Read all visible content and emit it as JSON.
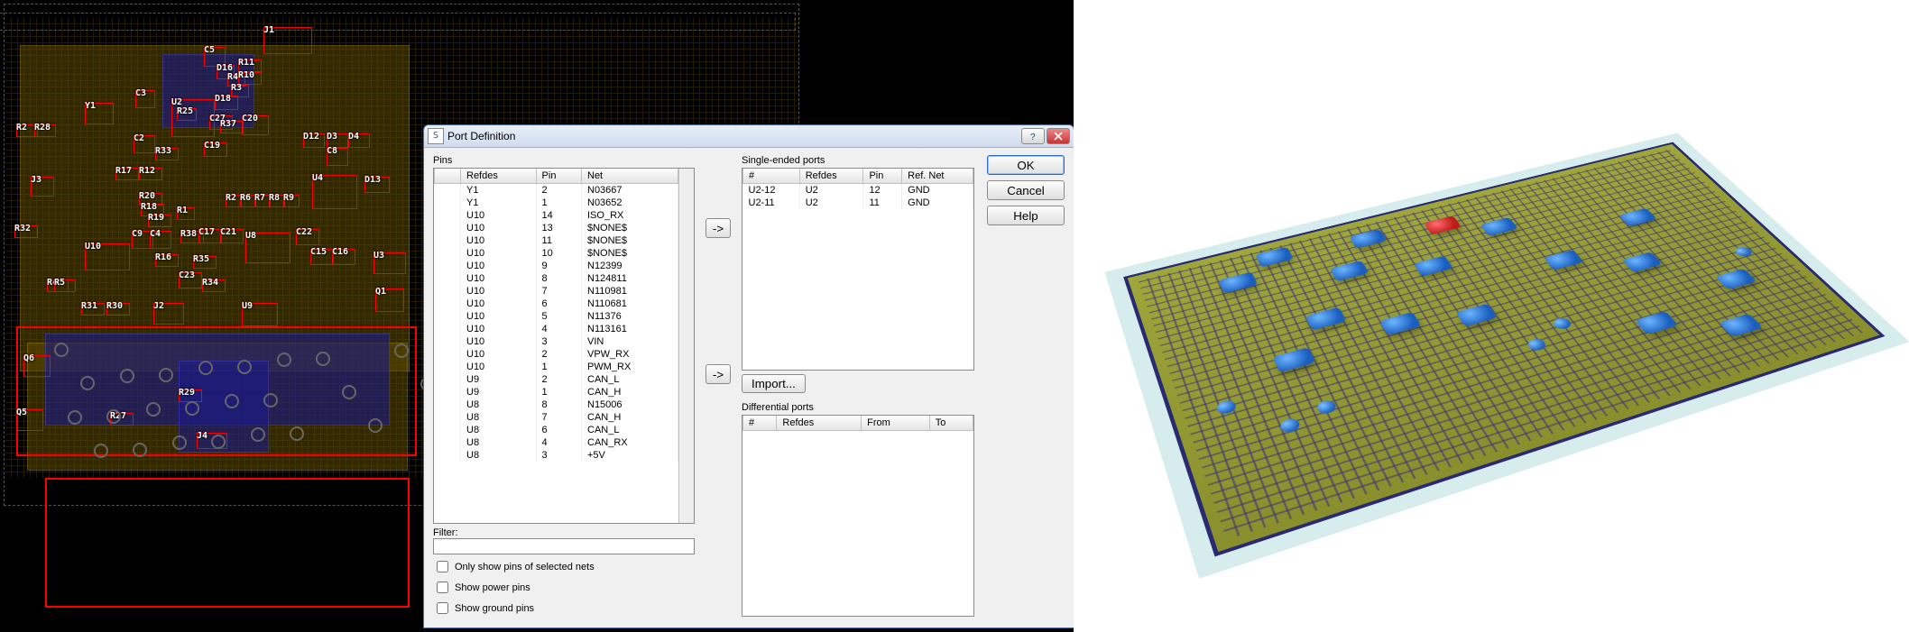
{
  "dialog": {
    "title": "Port Definition",
    "buttons": {
      "ok": "OK",
      "cancel": "Cancel",
      "help": "Help",
      "import": "Import...",
      "move": "->"
    },
    "pins": {
      "label": "Pins",
      "headers": [
        "Refdes",
        "Pin",
        "Net"
      ],
      "rows": [
        [
          "Y1",
          "2",
          "N03667"
        ],
        [
          "Y1",
          "1",
          "N03652"
        ],
        [
          "U10",
          "14",
          "ISO_RX"
        ],
        [
          "U10",
          "13",
          "$NONE$"
        ],
        [
          "U10",
          "11",
          "$NONE$"
        ],
        [
          "U10",
          "10",
          "$NONE$"
        ],
        [
          "U10",
          "9",
          "N12399"
        ],
        [
          "U10",
          "8",
          "N124811"
        ],
        [
          "U10",
          "7",
          "N110981"
        ],
        [
          "U10",
          "6",
          "N110681"
        ],
        [
          "U10",
          "5",
          "N11376"
        ],
        [
          "U10",
          "4",
          "N113161"
        ],
        [
          "U10",
          "3",
          "VIN"
        ],
        [
          "U10",
          "2",
          "VPW_RX"
        ],
        [
          "U10",
          "1",
          "PWM_RX"
        ],
        [
          "U9",
          "2",
          "CAN_L"
        ],
        [
          "U9",
          "1",
          "CAN_H"
        ],
        [
          "U8",
          "8",
          "N15006"
        ],
        [
          "U8",
          "7",
          "CAN_H"
        ],
        [
          "U8",
          "6",
          "CAN_L"
        ],
        [
          "U8",
          "4",
          "CAN_RX"
        ],
        [
          "U8",
          "3",
          "+5V"
        ]
      ],
      "filter_label": "Filter:",
      "filter_value": "",
      "cb1": "Only show pins of selected nets",
      "cb2": "Show power pins",
      "cb3": "Show ground pins"
    },
    "single": {
      "label": "Single-ended ports",
      "headers": [
        "#",
        "Refdes",
        "Pin",
        "Ref. Net"
      ],
      "rows": [
        [
          "U2-12",
          "U2",
          "12",
          "GND"
        ],
        [
          "U2-11",
          "U2",
          "11",
          "GND"
        ]
      ]
    },
    "diff": {
      "label": "Differential ports",
      "headers": [
        "#",
        "Refdes",
        "From",
        "To"
      ],
      "rows": []
    }
  },
  "pcb": {
    "refdes": [
      "J1",
      "C5",
      "R11",
      "D16",
      "R4",
      "R10",
      "R3",
      "C3",
      "D18",
      "Y1",
      "U2",
      "C27",
      "C20",
      "R25",
      "R37",
      "R33",
      "C2",
      "C19",
      "D12",
      "D3",
      "D4",
      "R2",
      "R28",
      "C8",
      "R17",
      "R12",
      "U4",
      "J3",
      "D13",
      "R2",
      "R6",
      "R7",
      "R8",
      "R9",
      "R20",
      "R18",
      "R19",
      "C9",
      "R1",
      "C4",
      "C22",
      "R38",
      "R32",
      "U8",
      "C17",
      "C21",
      "U10",
      "U3",
      "C15",
      "C16",
      "R35",
      "R16",
      "C23",
      "R34",
      "R4",
      "R5",
      "Q1",
      "R31",
      "R30",
      "J2",
      "U9",
      "Q6",
      "R29",
      "R27",
      "Q5",
      "J4"
    ]
  }
}
